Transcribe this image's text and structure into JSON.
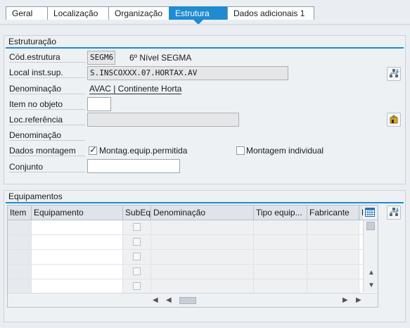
{
  "tabs": [
    {
      "label": "Geral",
      "active": false
    },
    {
      "label": "Localização",
      "active": false
    },
    {
      "label": "Organização",
      "active": false
    },
    {
      "label": "Estrutura",
      "active": true
    },
    {
      "label": "Dados adicionais 1",
      "active": false
    }
  ],
  "estruturacao": {
    "title": "Estruturação",
    "cod_estrutura": {
      "label": "Cód.estrutura",
      "value": "SEGM6",
      "desc": "6º Nível SEGMA"
    },
    "local_inst_sup": {
      "label": "Local inst.sup.",
      "value": "S.INSCOXXX.07.HORTAX.AV"
    },
    "denominacao1": {
      "label": "Denominação",
      "value": "AVAC | Continente Horta"
    },
    "item_no_objeto": {
      "label": "Item no objeto",
      "value": ""
    },
    "loc_referencia": {
      "label": "Loc.referência",
      "value": ""
    },
    "denominacao2": {
      "label": "Denominação",
      "value": ""
    },
    "dados_montagem": {
      "label": "Dados montagem",
      "montag_equip": {
        "label": "Montag.equip.permitida",
        "checked": true
      },
      "montagem_individual": {
        "label": "Montagem individual",
        "checked": false
      }
    },
    "conjunto": {
      "label": "Conjunto",
      "value": ""
    }
  },
  "equipamentos": {
    "title": "Equipamentos",
    "columns": [
      "Item",
      "Equipamento",
      "SubEq",
      "Denominação",
      "Tipo equip...",
      "Fabricante",
      "D"
    ],
    "row_count": 5
  },
  "icons": {
    "hierarchy_button": "hierarchy-icon",
    "reference_button": "reference-location-icon",
    "grid_settings": "grid-settings-icon",
    "equip_hierarchy": "equipment-hierarchy-icon"
  },
  "colors": {
    "accent": "#1f8bd0",
    "background": "#eaeef2"
  }
}
